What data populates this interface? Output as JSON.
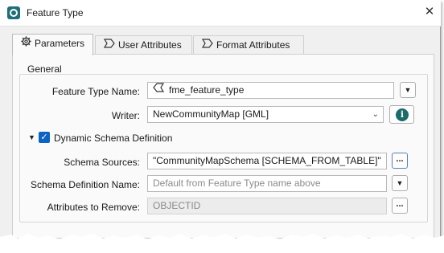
{
  "window": {
    "title": "Feature Type",
    "close_glyph": "✕"
  },
  "tabs": [
    {
      "label": "Parameters",
      "icon": "gear-icon",
      "active": true
    },
    {
      "label": "User Attributes",
      "icon": "tag-icon",
      "active": false
    },
    {
      "label": "Format Attributes",
      "icon": "tag-icon",
      "active": false
    }
  ],
  "general": {
    "group_label": "General",
    "feature_type_name": {
      "label": "Feature Type Name:",
      "value": "fme_feature_type",
      "icon": "feature-type-icon"
    },
    "writer": {
      "label": "Writer:",
      "value": "NewCommunityMap [GML]"
    },
    "info_glyph": "i"
  },
  "dynamic_schema": {
    "label": "Dynamic Schema Definition",
    "checked": true,
    "schema_sources": {
      "label": "Schema Sources:",
      "value": "\"CommunityMapSchema [SCHEMA_FROM_TABLE]\""
    },
    "schema_definition_name": {
      "label": "Schema Definition Name:",
      "placeholder": "Default from Feature Type name above"
    },
    "attributes_to_remove": {
      "label": "Attributes to Remove:",
      "value": "OBJECTID"
    }
  },
  "buttons": {
    "ellipsis": "...",
    "dropdown_glyph": "▼",
    "collapse_glyph": "▼",
    "check_glyph": "✓",
    "select_arrow": "⌄"
  },
  "colors": {
    "accent": "#0a64c2",
    "info": "#1c6b6b",
    "app_icon": "#1f6f78"
  }
}
